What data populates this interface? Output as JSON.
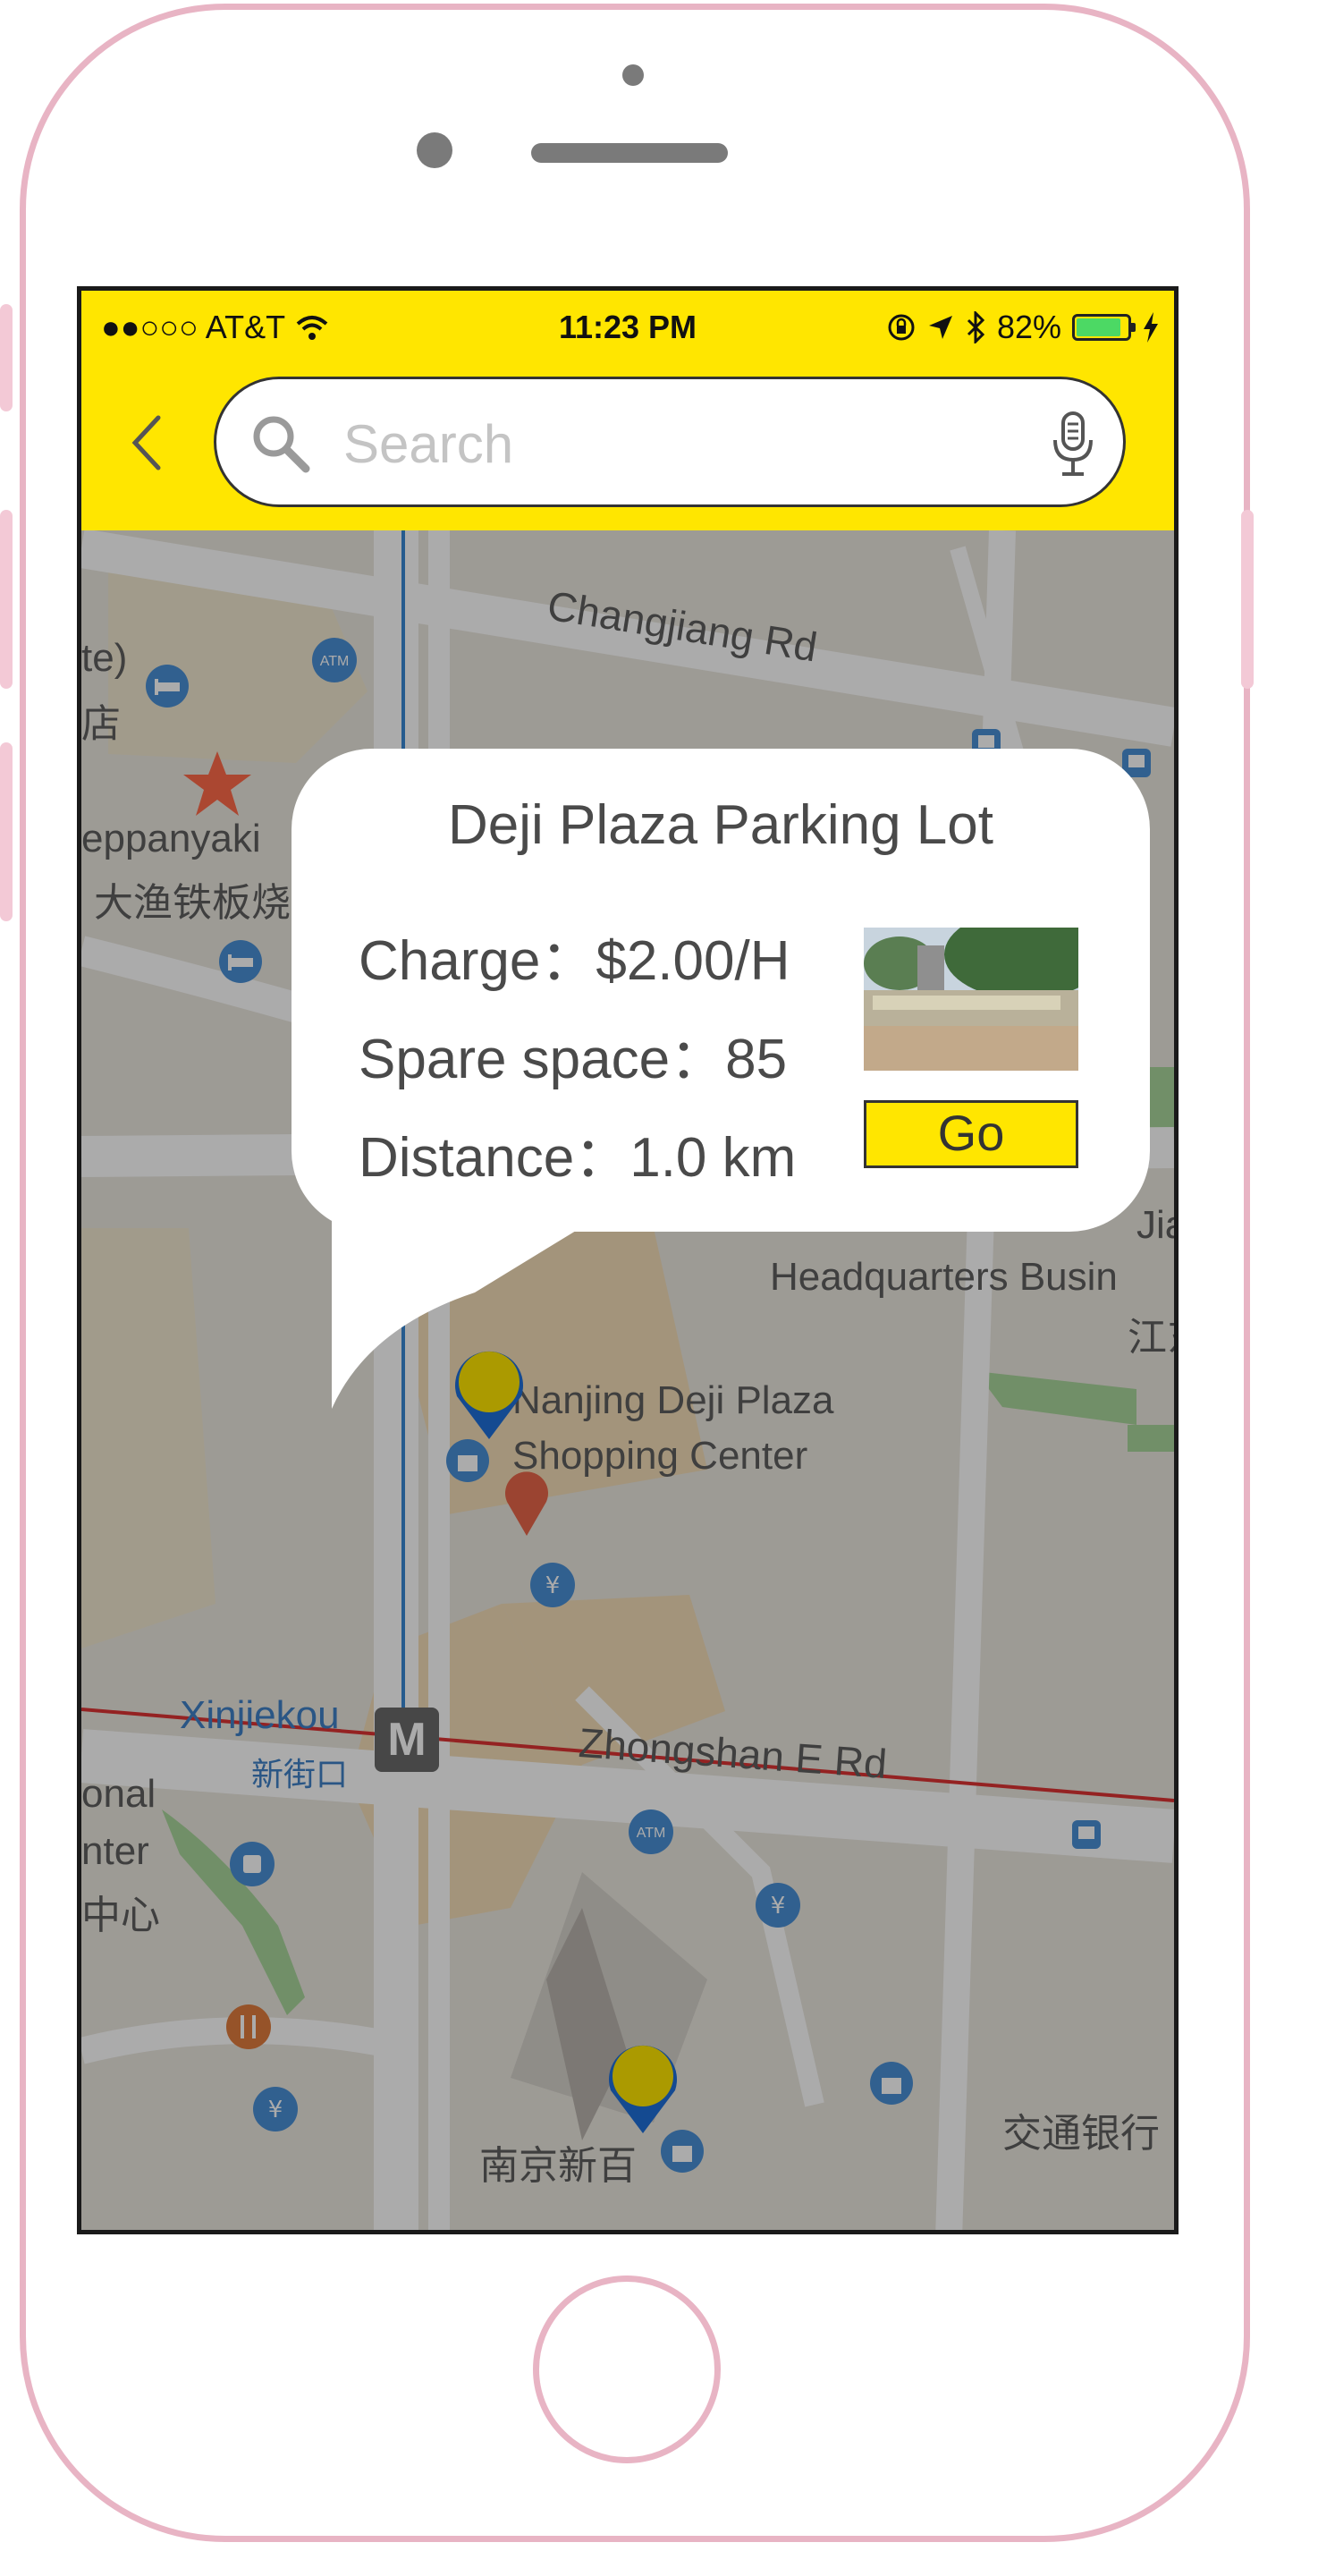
{
  "status_bar": {
    "carrier": "●●○○○ AT&T",
    "time": "11:23 PM",
    "battery": "82%",
    "battery_level": 0.82
  },
  "search": {
    "placeholder": "Search"
  },
  "map": {
    "labels": {
      "changjiang": "Changjiang Rd",
      "te": "te)",
      "dian": "店",
      "teppanyaki": "eppanyaki",
      "teppanyaki_cn": "大渔铁板烧",
      "headquarters": "Headquarters Busin",
      "jia": "Jia",
      "jiang": "江东",
      "deji1": "Nanjing Deji Plaza",
      "deji2": "Shopping Center",
      "xinjiekou": "Xinjiekou",
      "xinjiekou_cn": "新街口",
      "metro": "M",
      "zhongshan": "Zhongshan E Rd",
      "onal": "onal",
      "nter": "nter",
      "zhongxin": "中心",
      "nanjing_xinbai": "南京新百",
      "jiaotong": "交通银行",
      "atm": "ATM",
      "yen": "¥"
    }
  },
  "popup": {
    "title": "Deji Plaza Parking Lot",
    "charge": "Charge：$2.00/H",
    "spare": "Spare space：85",
    "distance": "Distance：1.0 km",
    "go_label": "Go"
  },
  "colors": {
    "accent": "#ffe600",
    "phone_frame": "#e8b4c4",
    "pin_blue": "#1e6fd9"
  }
}
